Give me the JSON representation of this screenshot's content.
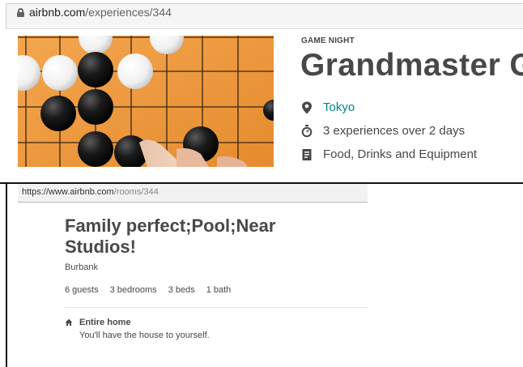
{
  "experience_page": {
    "url_domain": "airbnb.com",
    "url_path": "/experiences/344",
    "category": "GAME NIGHT",
    "title": "Grandmaster G",
    "location": "Tokyo",
    "schedule": "3 experiences over 2 days",
    "includes": "Food, Drinks and Equipment"
  },
  "room_page": {
    "url_domain": "https://www.airbnb.com",
    "url_path": "/rooms/344",
    "title": "Family perfect;Pool;Near Studios!",
    "city": "Burbank",
    "facts": [
      "6 guests",
      "3 bedrooms",
      "3 beds",
      "1 bath"
    ],
    "home_type_title": "Entire home",
    "home_type_sub": "You'll have the house to yourself."
  },
  "colors": {
    "link_teal": "#008489",
    "text": "#484848"
  }
}
